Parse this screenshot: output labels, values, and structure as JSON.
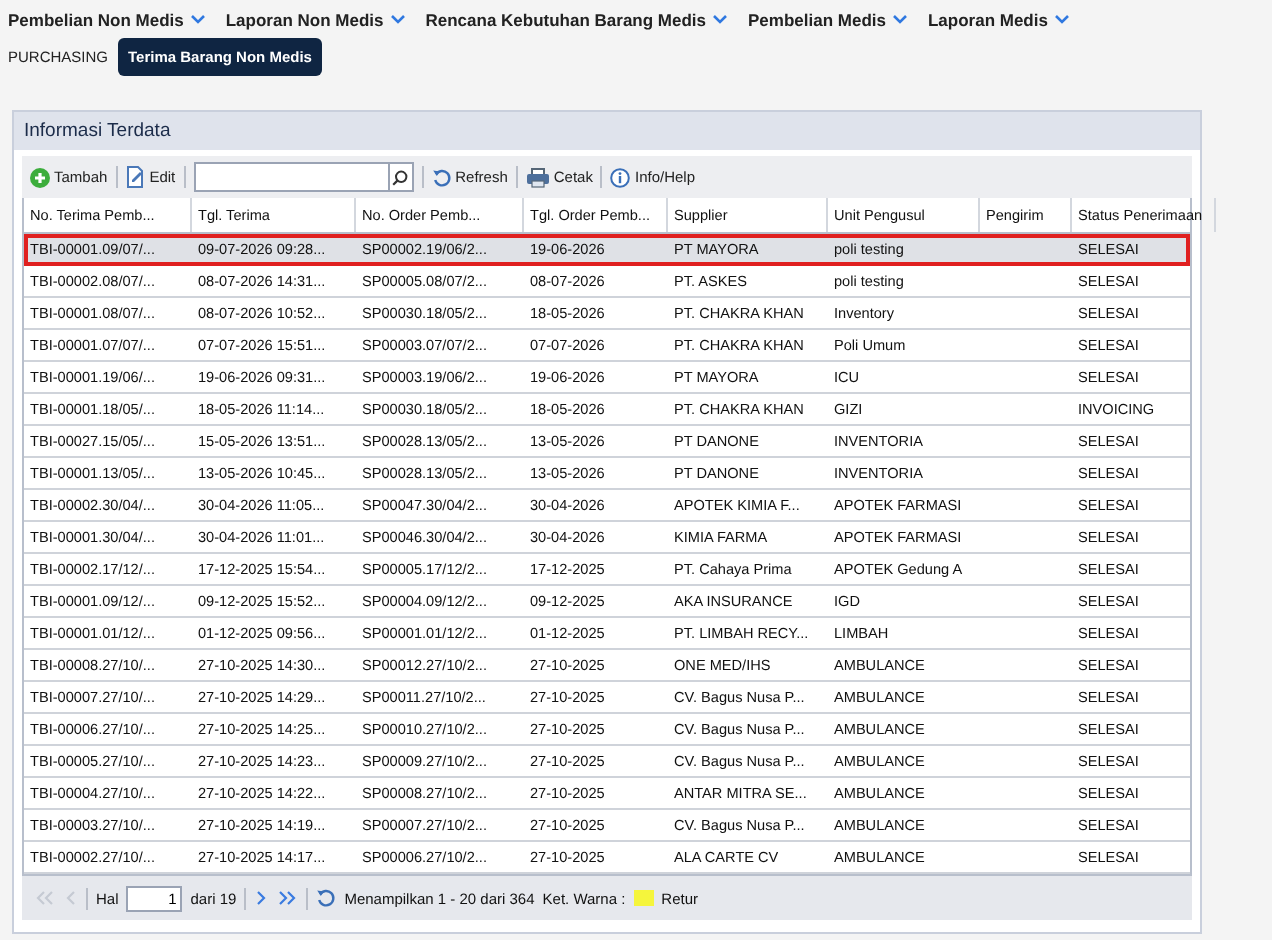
{
  "menu": [
    {
      "label": "Pembelian Non Medis"
    },
    {
      "label": "Laporan Non Medis"
    },
    {
      "label": "Rencana Kebutuhan Barang Medis"
    },
    {
      "label": "Pembelian Medis"
    },
    {
      "label": "Laporan Medis"
    }
  ],
  "breadcrumb": [
    {
      "label": "PURCHASING",
      "selected": false
    },
    {
      "label": "Terima Barang Non Medis",
      "selected": true
    }
  ],
  "panel": {
    "title": "Informasi Terdata"
  },
  "toolbar": [
    {
      "kind": "add",
      "label": "Tambah"
    },
    {
      "kind": "edit",
      "label": "Edit"
    },
    {
      "kind": "search"
    },
    {
      "kind": "refresh",
      "label": "Refresh"
    },
    {
      "kind": "print",
      "label": "Cetak"
    },
    {
      "kind": "info",
      "label": "Info/Help"
    }
  ],
  "table": {
    "columns": [
      "No. Terima Pemb...",
      "Tgl. Terima",
      "No. Order Pemb...",
      "Tgl. Order Pemb...",
      "Supplier",
      "Unit Pengusul",
      "Pengirim",
      "Status Penerimaan"
    ],
    "rows": [
      {
        "selected": true,
        "cells": [
          "TBI-00001.09/07/...",
          "09-07-2026 09:28...",
          "SP00002.19/06/2...",
          "19-06-2026",
          "PT MAYORA",
          "poli testing",
          "",
          "SELESAI"
        ]
      },
      {
        "selected": false,
        "cells": [
          "TBI-00002.08/07/...",
          "08-07-2026 14:31...",
          "SP00005.08/07/2...",
          "08-07-2026",
          "PT. ASKES",
          "poli testing",
          "",
          "SELESAI"
        ]
      },
      {
        "selected": false,
        "cells": [
          "TBI-00001.08/07/...",
          "08-07-2026 10:52...",
          "SP00030.18/05/2...",
          "18-05-2026",
          "PT. CHAKRA KHAN",
          "Inventory",
          "",
          "SELESAI"
        ]
      },
      {
        "selected": false,
        "cells": [
          "TBI-00001.07/07/...",
          "07-07-2026 15:51...",
          "SP00003.07/07/2...",
          "07-07-2026",
          "PT. CHAKRA KHAN",
          "Poli Umum",
          "",
          "SELESAI"
        ]
      },
      {
        "selected": false,
        "cells": [
          "TBI-00001.19/06/...",
          "19-06-2026 09:31...",
          "SP00003.19/06/2...",
          "19-06-2026",
          "PT MAYORA",
          "ICU",
          "",
          "SELESAI"
        ]
      },
      {
        "selected": false,
        "cells": [
          "TBI-00001.18/05/...",
          "18-05-2026 11:14...",
          "SP00030.18/05/2...",
          "18-05-2026",
          "PT. CHAKRA KHAN",
          "GIZI",
          "",
          "INVOICING"
        ]
      },
      {
        "selected": false,
        "cells": [
          "TBI-00027.15/05/...",
          "15-05-2026 13:51...",
          "SP00028.13/05/2...",
          "13-05-2026",
          "PT DANONE",
          "INVENTORIA",
          "",
          "SELESAI"
        ]
      },
      {
        "selected": false,
        "cells": [
          "TBI-00001.13/05/...",
          "13-05-2026 10:45...",
          "SP00028.13/05/2...",
          "13-05-2026",
          "PT DANONE",
          "INVENTORIA",
          "",
          "SELESAI"
        ]
      },
      {
        "selected": false,
        "cells": [
          "TBI-00002.30/04/...",
          "30-04-2026 11:05...",
          "SP00047.30/04/2...",
          "30-04-2026",
          "APOTEK KIMIA F...",
          "APOTEK FARMASI",
          "",
          "SELESAI"
        ]
      },
      {
        "selected": false,
        "cells": [
          "TBI-00001.30/04/...",
          "30-04-2026 11:01...",
          "SP00046.30/04/2...",
          "30-04-2026",
          "KIMIA FARMA",
          "APOTEK FARMASI",
          "",
          "SELESAI"
        ]
      },
      {
        "selected": false,
        "cells": [
          "TBI-00002.17/12/...",
          "17-12-2025 15:54...",
          "SP00005.17/12/2...",
          "17-12-2025",
          "PT. Cahaya Prima",
          "APOTEK Gedung A",
          "",
          "SELESAI"
        ]
      },
      {
        "selected": false,
        "cells": [
          "TBI-00001.09/12/...",
          "09-12-2025 15:52...",
          "SP00004.09/12/2...",
          "09-12-2025",
          "AKA INSURANCE",
          "IGD",
          "",
          "SELESAI"
        ]
      },
      {
        "selected": false,
        "cells": [
          "TBI-00001.01/12/...",
          "01-12-2025 09:56...",
          "SP00001.01/12/2...",
          "01-12-2025",
          "PT. LIMBAH RECY...",
          "LIMBAH",
          "",
          "SELESAI"
        ]
      },
      {
        "selected": false,
        "cells": [
          "TBI-00008.27/10/...",
          "27-10-2025 14:30...",
          "SP00012.27/10/2...",
          "27-10-2025",
          "ONE MED/IHS",
          "AMBULANCE",
          "",
          "SELESAI"
        ]
      },
      {
        "selected": false,
        "cells": [
          "TBI-00007.27/10/...",
          "27-10-2025 14:29...",
          "SP00011.27/10/2...",
          "27-10-2025",
          "CV. Bagus Nusa P...",
          "AMBULANCE",
          "",
          "SELESAI"
        ]
      },
      {
        "selected": false,
        "cells": [
          "TBI-00006.27/10/...",
          "27-10-2025 14:25...",
          "SP00010.27/10/2...",
          "27-10-2025",
          "CV. Bagus Nusa P...",
          "AMBULANCE",
          "",
          "SELESAI"
        ]
      },
      {
        "selected": false,
        "cells": [
          "TBI-00005.27/10/...",
          "27-10-2025 14:23...",
          "SP00009.27/10/2...",
          "27-10-2025",
          "CV. Bagus Nusa P...",
          "AMBULANCE",
          "",
          "SELESAI"
        ]
      },
      {
        "selected": false,
        "cells": [
          "TBI-00004.27/10/...",
          "27-10-2025 14:22...",
          "SP00008.27/10/2...",
          "27-10-2025",
          "ANTAR MITRA SE...",
          "AMBULANCE",
          "",
          "SELESAI"
        ]
      },
      {
        "selected": false,
        "cells": [
          "TBI-00003.27/10/...",
          "27-10-2025 14:19...",
          "SP00007.27/10/2...",
          "27-10-2025",
          "CV. Bagus Nusa P...",
          "AMBULANCE",
          "",
          "SELESAI"
        ]
      },
      {
        "selected": false,
        "cells": [
          "TBI-00002.27/10/...",
          "27-10-2025 14:17...",
          "SP00006.27/10/2...",
          "27-10-2025",
          "ALA CARTE CV",
          "AMBULANCE",
          "",
          "SELESAI"
        ]
      }
    ]
  },
  "pager": {
    "page_label": "Hal",
    "page": "1",
    "of": "dari 19",
    "first_disabled": true,
    "prev_disabled": true,
    "next_disabled": false,
    "last_disabled": false,
    "summary": "Menampilkan 1 - 20 dari 364",
    "legend_label": "Ket. Warna :",
    "legend": [
      {
        "label": "Retur",
        "color": "#f5f53c"
      }
    ]
  }
}
